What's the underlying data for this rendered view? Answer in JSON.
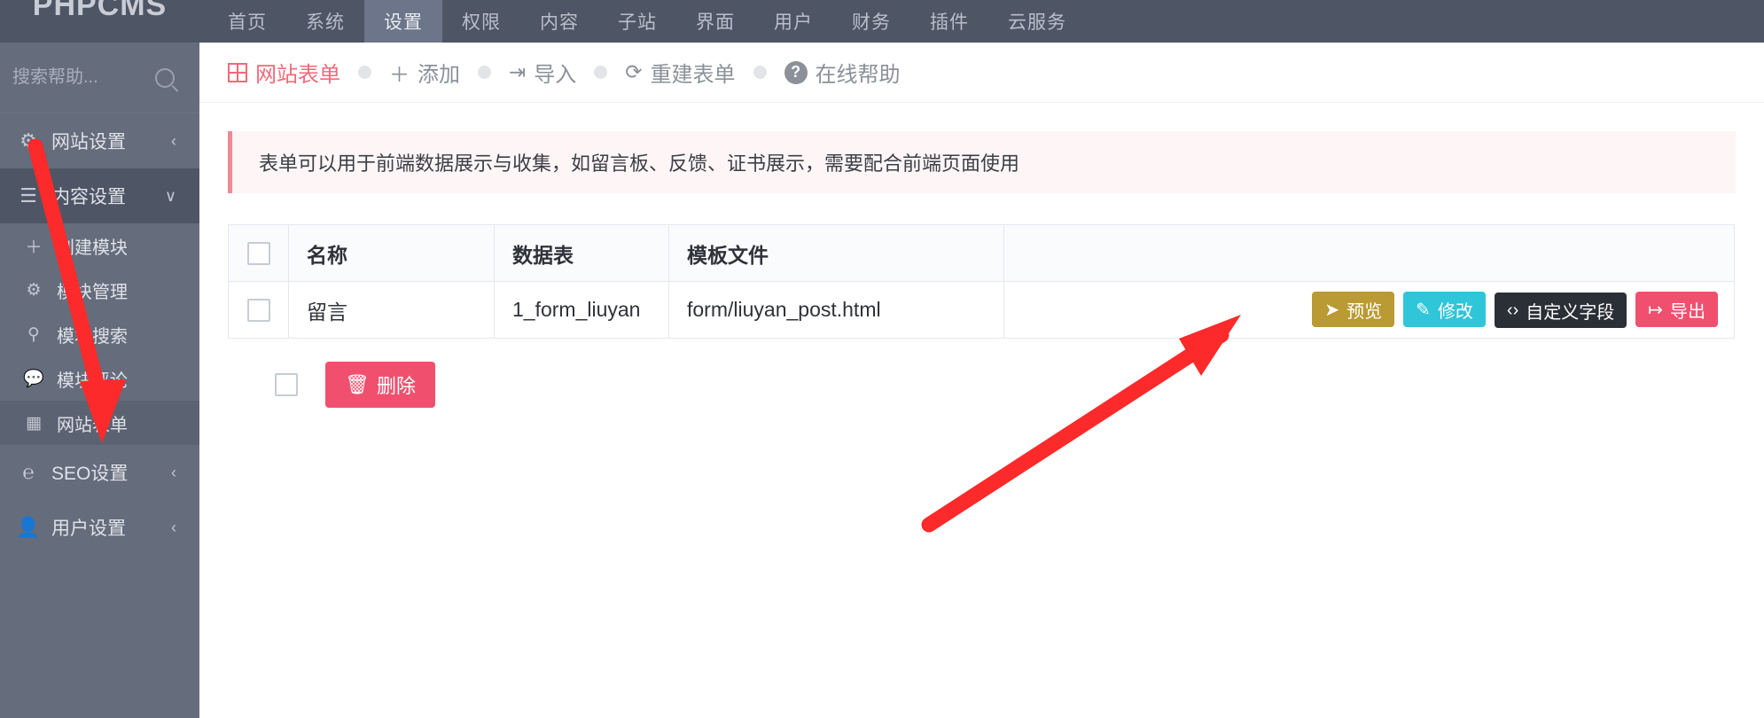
{
  "brand": {
    "text": "PHPCMS"
  },
  "topnav": {
    "items": [
      {
        "label": "首页",
        "active": false
      },
      {
        "label": "系统",
        "active": false
      },
      {
        "label": "设置",
        "active": true
      },
      {
        "label": "权限",
        "active": false
      },
      {
        "label": "内容",
        "active": false
      },
      {
        "label": "子站",
        "active": false
      },
      {
        "label": "界面",
        "active": false
      },
      {
        "label": "用户",
        "active": false
      },
      {
        "label": "财务",
        "active": false
      },
      {
        "label": "插件",
        "active": false
      },
      {
        "label": "云服务",
        "active": false
      }
    ]
  },
  "sidebar": {
    "search": {
      "placeholder": "搜索帮助...",
      "value": "",
      "icon": "search-icon"
    },
    "items": [
      {
        "label": "网站设置",
        "icon": "gear-icon",
        "glyph": "⚙",
        "chevron": "‹",
        "state": "collapsed",
        "sub": false
      },
      {
        "label": "内容设置",
        "icon": "hamburger-icon",
        "glyph": "☰",
        "chevron": "∨",
        "state": "open",
        "sub": false
      },
      {
        "label": "创建模块",
        "icon": "plus-icon",
        "glyph": "＋",
        "chevron": "",
        "state": "normal",
        "sub": true
      },
      {
        "label": "模块管理",
        "icon": "gears-icon",
        "glyph": "⚙",
        "chevron": "",
        "state": "normal",
        "sub": true
      },
      {
        "label": "模块搜索",
        "icon": "search-icon",
        "glyph": "⚲",
        "chevron": "",
        "state": "normal",
        "sub": true
      },
      {
        "label": "模块评论",
        "icon": "comment-icon",
        "glyph": "💬",
        "chevron": "",
        "state": "normal",
        "sub": true
      },
      {
        "label": "网站表单",
        "icon": "table-icon",
        "glyph": "▦",
        "chevron": "",
        "state": "selected",
        "sub": true
      },
      {
        "label": "SEO设置",
        "icon": "ie-icon",
        "glyph": "℮",
        "chevron": "‹",
        "state": "collapsed",
        "sub": false
      },
      {
        "label": "用户设置",
        "icon": "user-icon",
        "glyph": "👤",
        "chevron": "‹",
        "state": "collapsed",
        "sub": false
      }
    ]
  },
  "toolbar": {
    "items": [
      {
        "label": "网站表单",
        "icon": "table-icon",
        "glyph": "grid",
        "primary": true
      },
      {
        "label": "添加",
        "icon": "plus-icon",
        "glyph": "＋",
        "primary": false
      },
      {
        "label": "导入",
        "icon": "import-icon",
        "glyph": "⇥",
        "primary": false
      },
      {
        "label": "重建表单",
        "icon": "refresh-icon",
        "glyph": "⟳",
        "primary": false
      },
      {
        "label": "在线帮助",
        "icon": "help-circle-icon",
        "glyph": "?",
        "primary": false
      }
    ]
  },
  "notice": {
    "text": "表单可以用于前端数据展示与收集，如留言板、反馈、证书展示，需要配合前端页面使用"
  },
  "table": {
    "headers": [
      "名称",
      "数据表",
      "模板文件"
    ],
    "select_all_checked": false,
    "rows": [
      {
        "checked": false,
        "name": "留言",
        "db_table": "1_form_liuyan",
        "template": "form/liuyan_post.html",
        "actions": [
          {
            "label": "预览",
            "icon": "send-icon",
            "glyph": "➤",
            "style": "btn-preview"
          },
          {
            "label": "修改",
            "icon": "edit-icon",
            "glyph": "✎",
            "style": "btn-edit"
          },
          {
            "label": "自定义字段",
            "icon": "code-icon",
            "glyph": "‹›",
            "style": "btn-fields"
          },
          {
            "label": "导出",
            "icon": "export-icon",
            "glyph": "↦",
            "style": "btn-export"
          }
        ]
      }
    ]
  },
  "footer": {
    "bulk_checked": false,
    "delete_label": "删除",
    "delete_icon": "trash-icon",
    "delete_glyph": "🗑"
  },
  "annotations": {
    "arrow_color": "#fc2a2a",
    "arrow1": "points from 网站设置 down to 网站表单 sidebar item",
    "arrow2": "points from bottom-left up-right to 自定义字段 button"
  },
  "colors": {
    "nav_bg": "#4e5565",
    "sidebar_bg": "#656c7c",
    "accent_pink": "#f16a78",
    "danger": "#f0506e",
    "cyan": "#2ec6d8",
    "olive": "#b99a33",
    "dark": "#2b2f36"
  }
}
